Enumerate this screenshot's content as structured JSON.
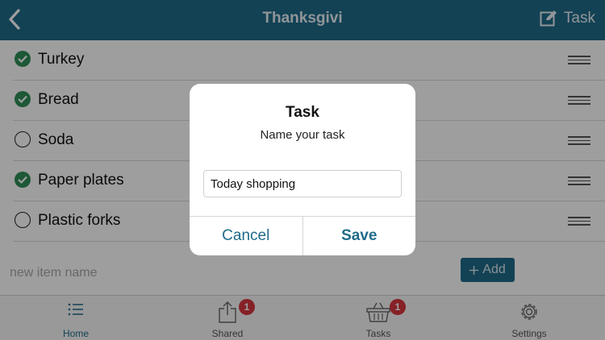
{
  "navbar": {
    "back_icon": "chevron-left-icon",
    "title": "Thanksgivi",
    "task_icon": "edit-icon",
    "task_label": "Task"
  },
  "list": {
    "items": [
      {
        "label": "Turkey",
        "done": true
      },
      {
        "label": "Bread",
        "done": true
      },
      {
        "label": "Soda",
        "done": false
      },
      {
        "label": "Paper plates",
        "done": true
      },
      {
        "label": "Plastic forks",
        "done": false
      }
    ]
  },
  "add": {
    "placeholder": "new item name",
    "button_label": "Add",
    "button_icon": "plus-icon"
  },
  "tabs": [
    {
      "label": "Home",
      "icon": "list-icon",
      "active": true
    },
    {
      "label": "Shared",
      "icon": "share-icon",
      "badge": "1"
    },
    {
      "label": "Tasks",
      "icon": "basket-icon",
      "badge": "1"
    },
    {
      "label": "Settings",
      "icon": "gear-icon"
    }
  ],
  "dialog": {
    "title": "Task",
    "message": "Name your task",
    "input_value": "Today shopping",
    "cancel_label": "Cancel",
    "save_label": "Save"
  },
  "colors": {
    "accent": "#1f6b8a",
    "check": "#2f8f59",
    "badge": "#d9363e"
  }
}
